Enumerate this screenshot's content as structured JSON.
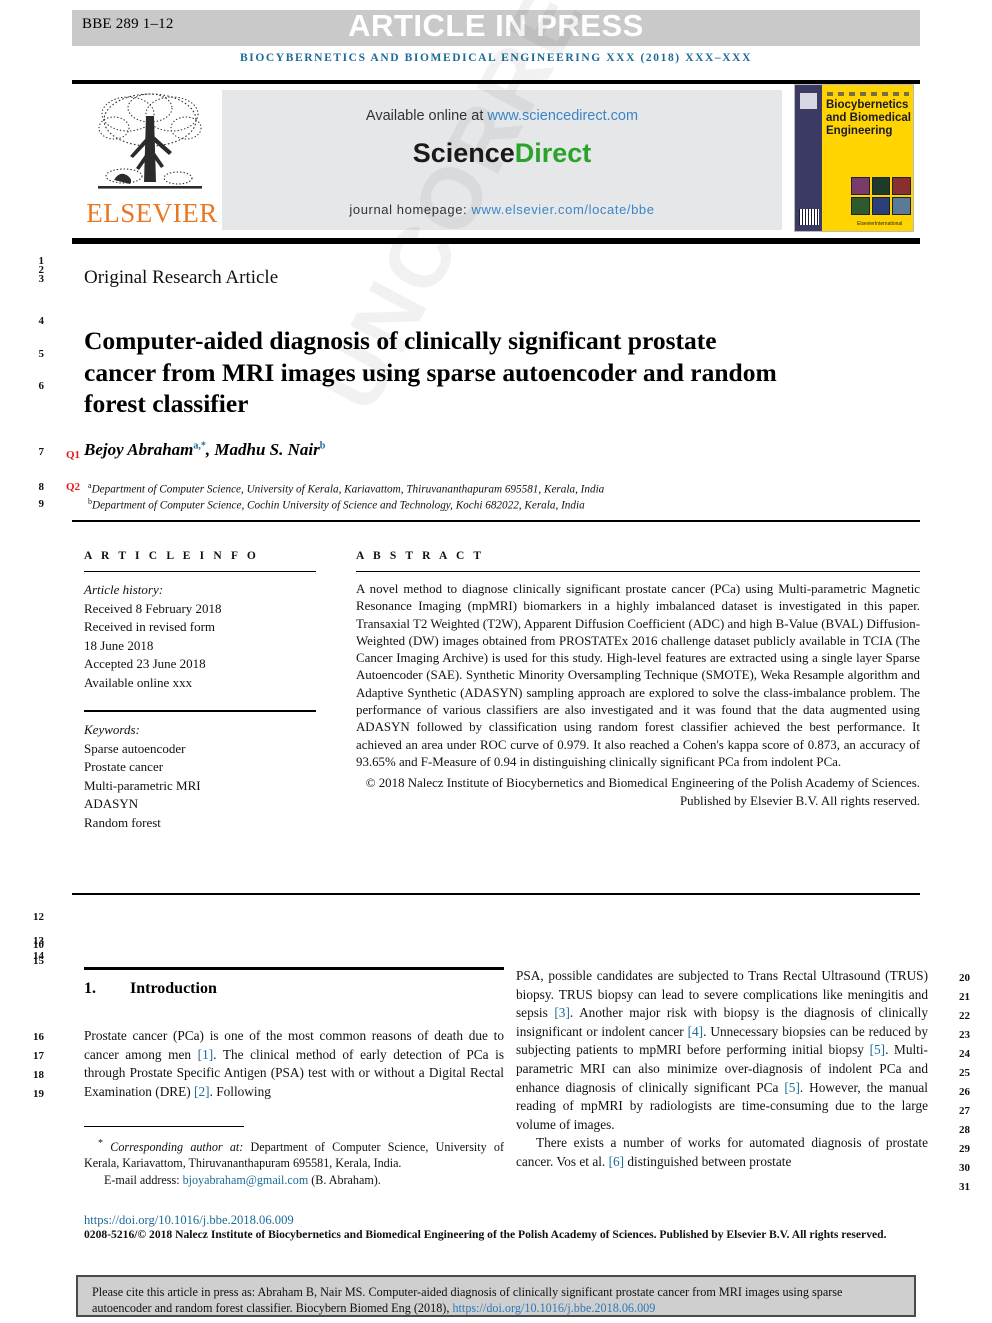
{
  "header": {
    "proof_id": "BBE 289 1–12",
    "article_in_press": "ARTICLE IN PRESS",
    "running_head": "Biocybernetics and Biomedical Engineering xxx (2018) xxx–xxx"
  },
  "masthead": {
    "elsevier_wordmark": "ELSEVIER",
    "available_prefix": "Available online at ",
    "available_link": "www.sciencedirect.com",
    "sciencedirect_sci": "Science",
    "sciencedirect_direct": "Direct",
    "homepage_prefix": "journal homepage: ",
    "homepage_link": "www.elsevier.com/locate/bbe",
    "cover_title": "Biocybernetics and Biomedical Engineering",
    "cover_publisher": "ElsevierInternational"
  },
  "watermark": "UNCORRECTED PROOF",
  "article": {
    "type": "Original Research Article",
    "title": "Computer-aided diagnosis of clinically significant prostate cancer from MRI images using sparse autoencoder and random forest classifier",
    "authors_plain": "Bejoy Abraham",
    "author1": "Bejoy Abraham",
    "author1_sup": "a,*",
    "author2": "Madhu S. Nair",
    "author2_sup": "b",
    "affiliation_a_sup": "a",
    "affiliation_a": "Department of Computer Science, University of Kerala, Kariavattom, Thiruvananthapuram 695581, Kerala, India",
    "affiliation_b_sup": "b",
    "affiliation_b": "Department of Computer Science, Cochin University of Science and Technology, Kochi 682022, Kerala, India",
    "query_marks": [
      "Q1",
      "Q2"
    ]
  },
  "article_info": {
    "heading": "A R T I C L E   I N F O",
    "history_label": "Article history:",
    "history": [
      "Received 8 February 2018",
      "Received in revised form",
      "18 June 2018",
      "Accepted 23 June 2018",
      "Available online xxx"
    ],
    "keywords_label": "Keywords:",
    "keywords": [
      "Sparse autoencoder",
      "Prostate cancer",
      "Multi-parametric MRI",
      "ADASYN",
      "Random forest"
    ]
  },
  "abstract": {
    "heading": "A B S T R A C T",
    "body": "A novel method to diagnose clinically significant prostate cancer (PCa) using Multi-parametric Magnetic Resonance Imaging (mpMRI) biomarkers in a highly imbalanced dataset is investigated in this paper. Transaxial T2 Weighted (T2W), Apparent Diffusion Coefficient (ADC) and high B-Value (BVAL) Diffusion-Weighted (DW) images obtained from PROSTATEx 2016 challenge dataset publicly available in TCIA (The Cancer Imaging Archive) is used for this study. High-level features are extracted using a single layer Sparse Autoencoder (SAE). Synthetic Minority Oversampling Technique (SMOTE), Weka Resample algorithm and Adaptive Synthetic (ADASYN) sampling approach are explored to solve the class-imbalance problem. The performance of various classifiers are also investigated and it was found that the data augmented using ADASYN followed by classification using random forest classifier achieved the best performance. It achieved an area under ROC curve of 0.979. It also reached a Cohen's kappa score of 0.873, an accuracy of 93.65% and F-Measure of 0.94 in distinguishing clinically significant PCa from indolent PCa.",
    "copyright": "© 2018 Nalecz Institute of Biocybernetics and Biomedical Engineering of the Polish Academy of Sciences. Published by Elsevier B.V. All rights reserved."
  },
  "body": {
    "section_number": "1.",
    "section_title": "Introduction",
    "left_paragraph_1_a": "Prostate cancer (PCa) is one of the most common reasons of death due to cancer among men ",
    "left_ref_1": "[1]",
    "left_paragraph_1_b": ". The clinical method of early detection of PCa is through Prostate Specific Antigen (PSA) test with or without a Digital Rectal Examination (DRE) ",
    "left_ref_2": "[2]",
    "left_paragraph_1_c": ". Following",
    "right_p1_a": "PSA, possible candidates are subjected to Trans Rectal Ultrasound (TRUS) biopsy. TRUS biopsy can lead to severe complications like meningitis and sepsis ",
    "right_ref_3": "[3]",
    "right_p1_b": ". Another major risk with biopsy is the diagnosis of clinically insignificant or indolent cancer ",
    "right_ref_4": "[4]",
    "right_p1_c": ". Unnecessary biopsies can be reduced by subjecting patients to mpMRI before performing initial biopsy ",
    "right_ref_5a": "[5]",
    "right_p1_d": ". Multi-parametric MRI can also minimize over-diagnosis of indolent PCa and enhance diagnosis of clinically significant PCa ",
    "right_ref_5b": "[5]",
    "right_p1_e": ". However, the manual reading of mpMRI by radiologists are time-consuming due to the large volume of images.",
    "right_p2_a": "There exists a number of works for automated diagnosis of prostate cancer. Vos et al. ",
    "right_ref_6": "[6]",
    "right_p2_b": " distinguished between prostate"
  },
  "footnote": {
    "star": "*",
    "corresponding_label": "Corresponding author at:",
    "corresponding_text": " Department of Computer Science, University of Kerala, Kariavattom, Thiruvananthapuram 695581, Kerala, India.",
    "email_label": "E-mail address: ",
    "email": "bjoyabraham@gmail.com",
    "email_suffix": " (B. Abraham).",
    "doi": "https://doi.org/10.1016/j.bbe.2018.06.009",
    "issn_line": "0208-5216/© 2018 Nalecz Institute of Biocybernetics and Biomedical Engineering of the Polish Academy of Sciences. Published by Elsevier B.V. All rights reserved."
  },
  "citation_box": {
    "text_a": "Please cite this article in press as: Abraham  B, Nair  MS. Computer-aided diagnosis of clinically significant prostate cancer from MRI images using sparse autoencoder and random forest classifier. Biocybern Biomed Eng (2018), ",
    "link": "https://doi.org/10.1016/j.bbe.2018.06.009"
  },
  "line_numbers": {
    "left": [
      "1",
      "2",
      "3",
      "4",
      "5",
      "6",
      "7",
      "8",
      "9",
      "12",
      "13",
      "10",
      "14",
      "15",
      "16",
      "17",
      "18",
      "19"
    ],
    "right": [
      "20",
      "21",
      "22",
      "23",
      "24",
      "25",
      "26",
      "27",
      "28",
      "29",
      "30",
      "31"
    ]
  },
  "colors": {
    "banner_grey": "#c9c9c9",
    "journal_blue": "#1b6a99",
    "link_blue": "#3a86c8",
    "elsevier_orange": "#e87722",
    "sciencedirect_green": "#2aa32a",
    "query_red": "#e01b1b",
    "cover_yellow": "#ffd400",
    "cite_box_grey": "#cfcfcf"
  }
}
